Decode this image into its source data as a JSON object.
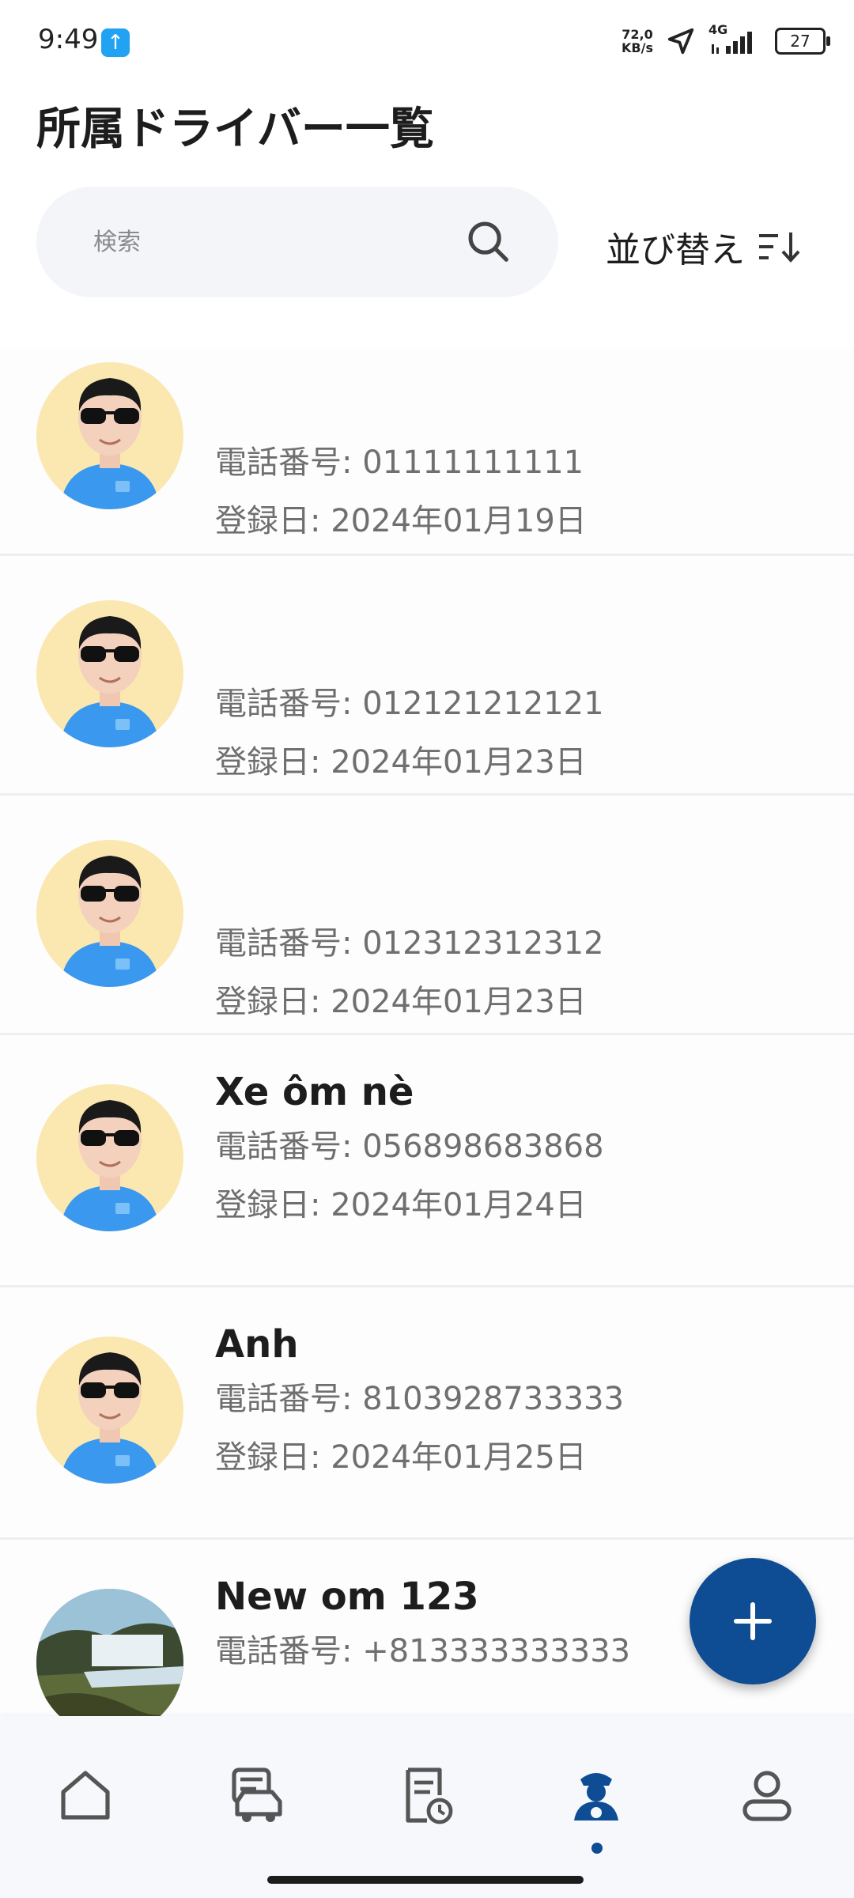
{
  "status_bar": {
    "time": "9:49",
    "upload_icon": "arrow-up-icon",
    "speed_value": "72,0",
    "speed_unit": "KB/s",
    "network": "4G",
    "battery": "27"
  },
  "header": {
    "title": "所属ドライバー一覧"
  },
  "search": {
    "placeholder": "検索",
    "value": ""
  },
  "sort": {
    "label": "並び替え",
    "icon": "sort-icon"
  },
  "drivers": [
    {
      "name": "",
      "phone": "電話番号: 01111111111",
      "date": "登録日: 2024年01月19日",
      "avatar": "cartoon-avatar"
    },
    {
      "name": "",
      "phone": "電話番号: 012121212121",
      "date": "登録日: 2024年01月23日",
      "avatar": "cartoon-avatar"
    },
    {
      "name": "",
      "phone": "電話番号: 012312312312",
      "date": "登録日: 2024年01月23日",
      "avatar": "cartoon-avatar"
    },
    {
      "name": "Xe ôm nè",
      "phone": "電話番号: 056898683868",
      "date": "登録日: 2024年01月24日",
      "avatar": "cartoon-avatar"
    },
    {
      "name": "Anh",
      "phone": "電話番号: 8103928733333",
      "date": "登録日: 2024年01月25日",
      "avatar": "cartoon-avatar"
    },
    {
      "name": "New om 123",
      "phone": "電話番号: +813333333333",
      "date": "",
      "avatar": "landscape-photo"
    }
  ],
  "fab": {
    "icon": "plus-icon"
  },
  "bottom_nav": {
    "items": [
      {
        "icon": "home-icon",
        "active": false
      },
      {
        "icon": "car-icon",
        "active": false
      },
      {
        "icon": "document-clock-icon",
        "active": false
      },
      {
        "icon": "driver-icon",
        "active": true
      },
      {
        "icon": "profile-icon",
        "active": false
      }
    ]
  },
  "colors": {
    "primary": "#0e4c94",
    "avatar_bg": "#fbe7b0",
    "search_bg": "#f3f5f9"
  }
}
